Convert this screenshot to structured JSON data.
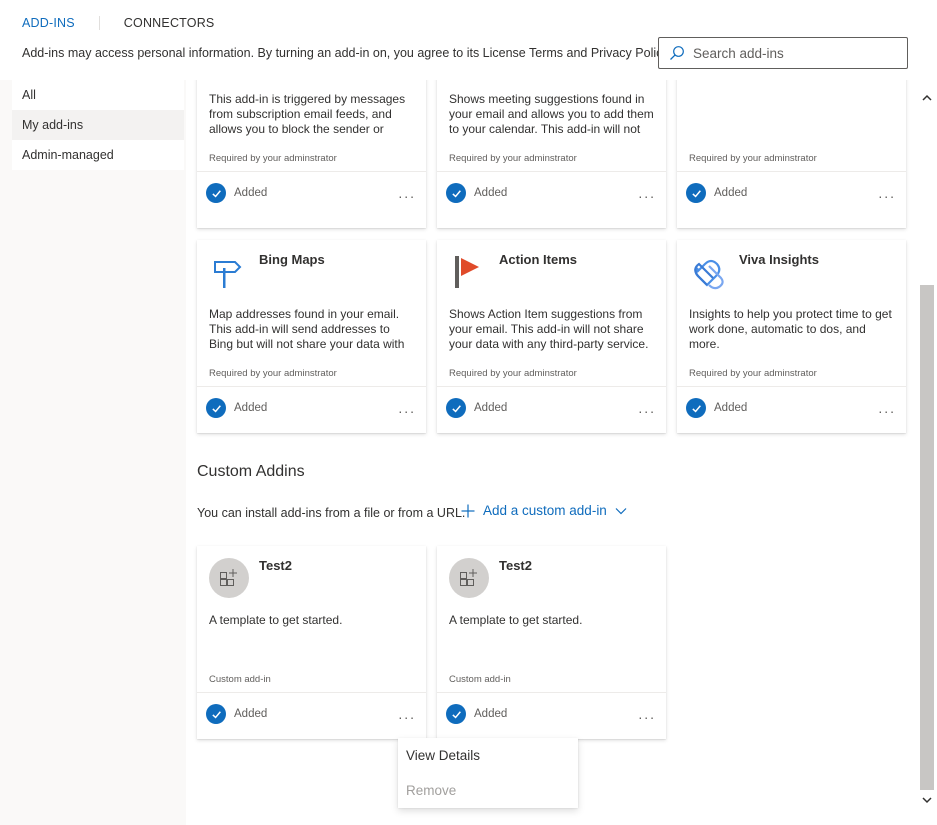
{
  "tabs": [
    {
      "label": "ADD-INS"
    },
    {
      "label": "CONNECTORS"
    }
  ],
  "disclaimer": "Add-ins may access personal information. By turning an add-in on, you agree to its License Terms and Privacy Policy.",
  "search": {
    "placeholder": "Search add-ins"
  },
  "nav": [
    {
      "label": "All"
    },
    {
      "label": "My add-ins"
    },
    {
      "label": "Admin-managed"
    }
  ],
  "cards_row1": [
    {
      "desc": "This add-in is triggered by messages from subscription email feeds, and allows you to block the sender or",
      "req": "Required by your adminstrator",
      "status": "Added"
    },
    {
      "desc": "Shows meeting suggestions found in your email and allows you to add them to your calendar. This add-in will not",
      "req": "Required by your adminstrator",
      "status": "Added"
    },
    {
      "desc": "",
      "req": "Required by your adminstrator",
      "status": "Added"
    }
  ],
  "cards_row2": [
    {
      "name": "Bing Maps",
      "icon": "signpost-icon",
      "desc": "Map addresses found in your email. This add-in will send addresses to Bing but will not share your data with any",
      "req": "Required by your adminstrator",
      "status": "Added"
    },
    {
      "name": "Action Items",
      "icon": "flag-icon",
      "desc": "Shows Action Item suggestions from your email. This add-in will not share your data with any third-party service.",
      "req": "Required by your adminstrator",
      "status": "Added"
    },
    {
      "name": "Viva Insights",
      "icon": "viva-insights-icon",
      "desc": "Insights to help you protect time to get work done, automatic to dos, and more.",
      "req": "Required by your adminstrator",
      "status": "Added"
    }
  ],
  "custom": {
    "title": "Custom Addins",
    "install_text": "You can install add-ins from a file or from a URL.",
    "add_label": "Add a custom add-in",
    "cards": [
      {
        "name": "Test2",
        "desc": "A template to get started.",
        "req": "Custom add-in",
        "status": "Added"
      },
      {
        "name": "Test2",
        "desc": "A template to get started.",
        "req": "Custom add-in",
        "status": "Added"
      }
    ]
  },
  "more_label": "...",
  "context_menu": [
    {
      "label": "View Details",
      "enabled": true
    },
    {
      "label": "Remove",
      "enabled": false
    }
  ],
  "colors": {
    "accent": "#0f6cbd",
    "action_items_red": "#e04b2a"
  }
}
